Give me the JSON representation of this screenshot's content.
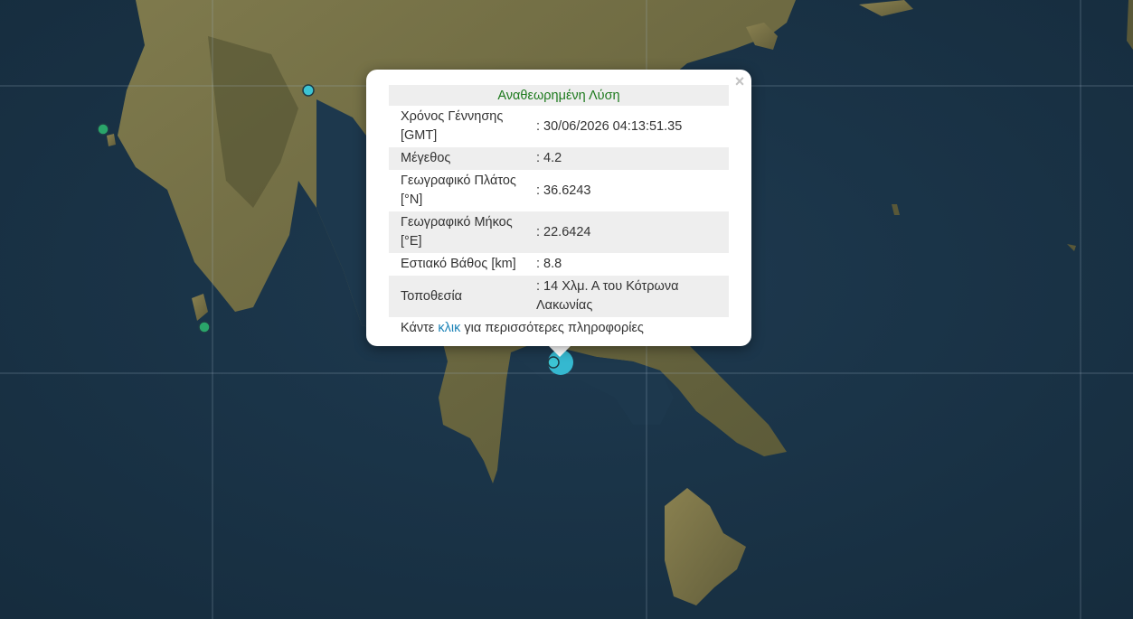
{
  "popup": {
    "title": "Αναθεωρημένη Λύση",
    "close_symbol": "×",
    "rows": [
      {
        "label": "Χρόνος Γέννησης [GMT]",
        "value": ": 30/06/2026 04:13:51.35"
      },
      {
        "label": "Μέγεθος",
        "value": ": 4.2"
      },
      {
        "label": "Γεωγραφικό Πλάτος [°N]",
        "value": ": 36.6243"
      },
      {
        "label": "Γεωγραφικό Μήκος [°E]",
        "value": ": 22.6424"
      },
      {
        "label": "Εστιακό Βάθος [km]",
        "value": ": 8.8"
      },
      {
        "label": "Τοποθεσία",
        "value": ": 14 Χλμ. Α του Κότρωνα Λακωνίας"
      }
    ],
    "more_prefix": "Κάντε",
    "more_link": "κλικ",
    "more_suffix": "για περισσότερες πληροφορίες"
  },
  "map": {
    "basemap": "satellite imagery",
    "marker_colors": {
      "recent": "#3cc4d4",
      "older": "#2aa56a",
      "selected": "#35b8d0"
    }
  }
}
